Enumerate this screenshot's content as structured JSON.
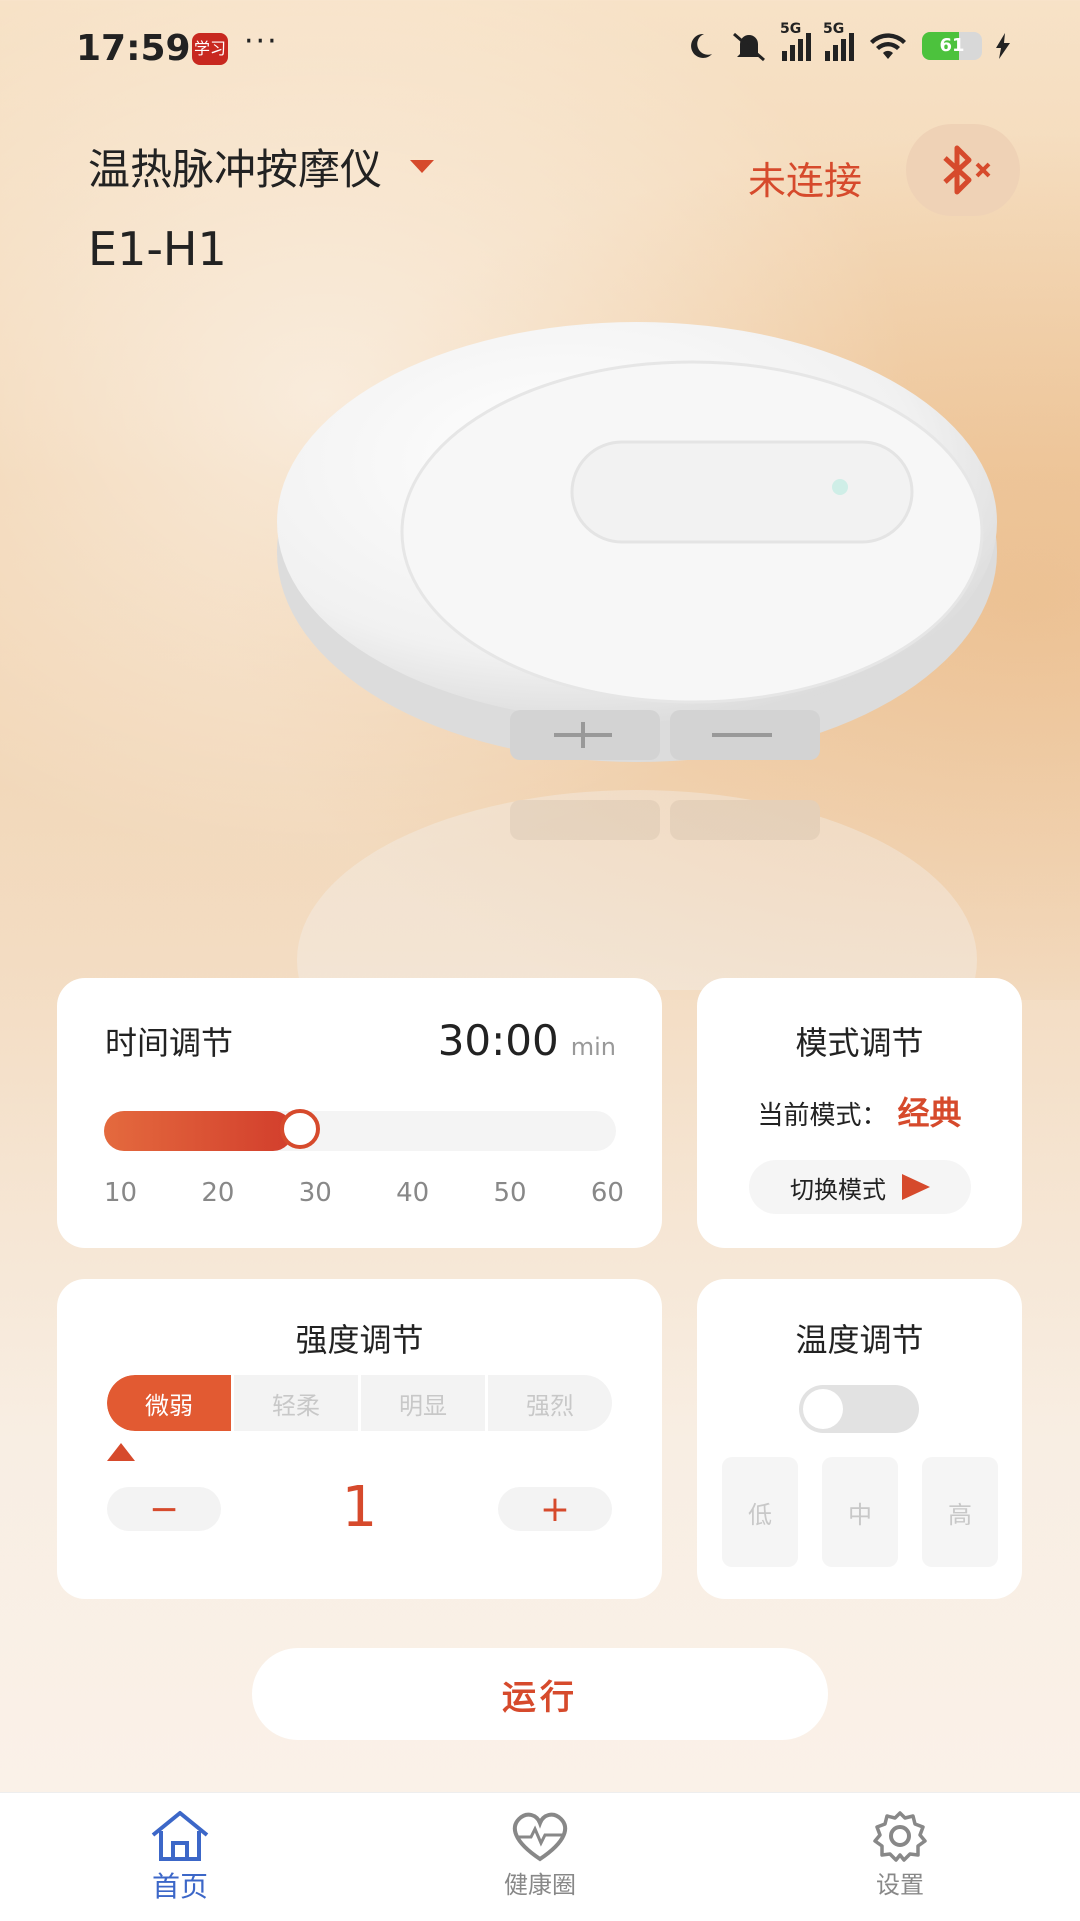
{
  "status_bar": {
    "time": "17:59",
    "app_badge": "学习",
    "dots": "···",
    "signal1_label": "5G",
    "signal2_label": "5G",
    "battery": "61"
  },
  "header": {
    "device_name": "温热脉冲按摩仪",
    "model": "E1-H1",
    "connection_status": "未连接"
  },
  "time_card": {
    "title": "时间调节",
    "value": "30:00",
    "unit": "min",
    "slider_fraction": 0.37,
    "ticks": [
      "10",
      "20",
      "30",
      "40",
      "50",
      "60"
    ]
  },
  "mode_card": {
    "title": "模式调节",
    "current_label": "当前模式：",
    "current_value": "经典",
    "switch_label": "切换模式"
  },
  "intensity_card": {
    "title": "强度调节",
    "levels": [
      "微弱",
      "轻柔",
      "明显",
      "强烈"
    ],
    "minus": "−",
    "plus": "+",
    "value": "1"
  },
  "temp_card": {
    "title": "温度调节",
    "options": [
      "低",
      "中",
      "高"
    ]
  },
  "run_label": "运行",
  "nav": {
    "home": "首页",
    "health": "健康圈",
    "settings": "设置"
  },
  "colors": {
    "accent": "#d64a2c",
    "nav_active": "#3c67c8"
  }
}
